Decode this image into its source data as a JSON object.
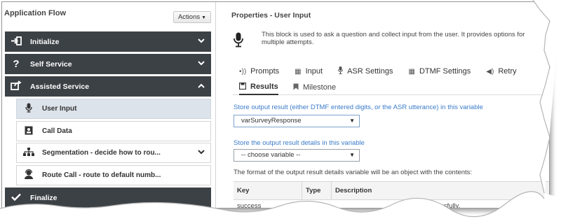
{
  "left": {
    "title": "Application Flow",
    "actions_label": "Actions",
    "sections": [
      {
        "label": "Initialize",
        "icon": "sign-in-icon",
        "chevron": "⌄"
      },
      {
        "label": "Self Service",
        "icon": "question-icon",
        "chevron": "⌄"
      },
      {
        "label": "Assisted Service",
        "icon": "share-icon",
        "chevron": "⌃"
      },
      {
        "label": "Finalize",
        "icon": "check-icon",
        "chevron": ""
      }
    ],
    "items": [
      {
        "label": "User Input",
        "icon": "microphone-icon",
        "active": true
      },
      {
        "label": "Call Data",
        "icon": "contact-card-icon",
        "active": false
      },
      {
        "label": "Segmentation - decide how to rou...",
        "icon": "hierarchy-icon",
        "active": false
      },
      {
        "label": "Route Call - route to default numb...",
        "icon": "agent-icon",
        "active": false
      }
    ]
  },
  "right": {
    "title": "Properties - User Input",
    "description": "This block is used to ask a question and collect input from the user. It provides options for multiple attempts.",
    "tabs_row1": [
      {
        "label": "Prompts",
        "icon": "sound-icon"
      },
      {
        "label": "Input",
        "icon": "grid-icon"
      },
      {
        "label": "ASR Settings",
        "icon": "mic-small-icon"
      },
      {
        "label": "DTMF Settings",
        "icon": "keypad-icon"
      },
      {
        "label": "Retry",
        "icon": "speaker-icon"
      }
    ],
    "tabs_row2": [
      {
        "label": "Results",
        "icon": "save-icon",
        "active": true
      },
      {
        "label": "Milestone",
        "icon": "bookmark-icon",
        "active": false
      }
    ],
    "store_result_label": "Store output result (either DTMF entered digits, or the ASR utterance) in this variable",
    "store_result_value": "varSurveyResponse",
    "store_details_label": "Store the output result details in this variable",
    "store_details_value": "-- choose variable --",
    "format_text": "The format of the output result details variable will be an object with the contents:",
    "table": {
      "headers": [
        "Key",
        "Type",
        "Description"
      ],
      "rows": [
        {
          "key": "success",
          "type": "",
          "desc": "ssfully."
        }
      ]
    }
  }
}
